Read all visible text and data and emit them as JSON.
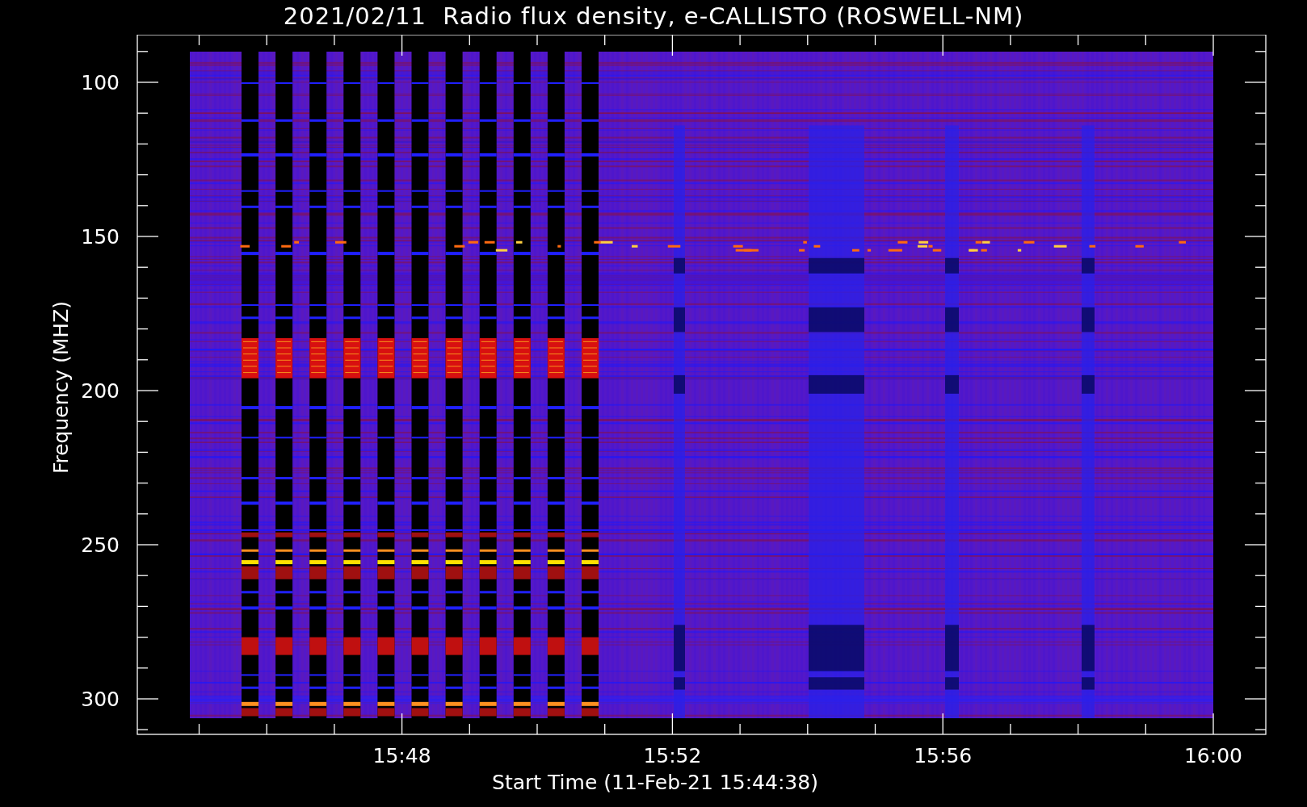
{
  "title": "2021/02/11  Radio flux density, e-CALLISTO (ROSWELL-NM)",
  "y_axis": {
    "label": "Frequency (MHZ)",
    "ticks": [
      "100",
      "150",
      "200",
      "250",
      "300"
    ]
  },
  "x_axis": {
    "label": "Start Time (11-Feb-21 15:44:38)",
    "ticks": [
      "15:48",
      "15:52",
      "15:56",
      "16:00"
    ]
  }
}
